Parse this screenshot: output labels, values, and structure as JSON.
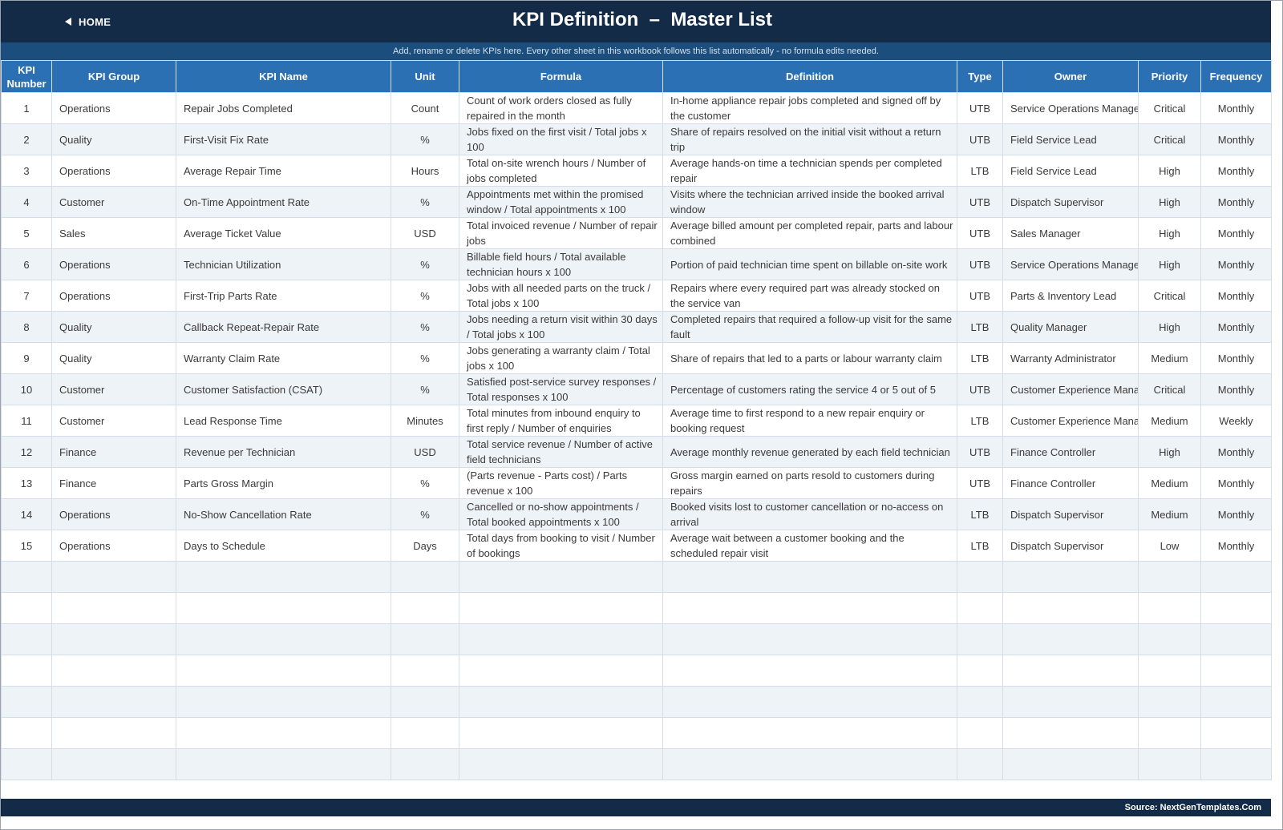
{
  "header": {
    "home_label": "HOME",
    "title": "KPI Definition  –  Master List",
    "subtitle": "Add, rename or delete KPIs here. Every other sheet in this workbook follows this list automatically - no formula edits needed."
  },
  "table": {
    "columns": [
      "KPI Number",
      "KPI Group",
      "KPI Name",
      "Unit",
      "Formula",
      "Definition",
      "Type",
      "Owner",
      "Priority",
      "Frequency"
    ],
    "rows": [
      {
        "number": "1",
        "group": "Operations",
        "name": "Repair Jobs Completed",
        "unit": "Count",
        "formula": "Count of work orders closed as fully repaired in the month",
        "definition": "In-home appliance repair jobs completed and signed off by the customer",
        "type": "UTB",
        "owner": "Service Operations Manager",
        "priority": "Critical",
        "frequency": "Monthly"
      },
      {
        "number": "2",
        "group": "Quality",
        "name": "First-Visit Fix Rate",
        "unit": "%",
        "formula": "Jobs fixed on the first visit / Total jobs x 100",
        "definition": "Share of repairs resolved on the initial visit without a return trip",
        "type": "UTB",
        "owner": "Field Service Lead",
        "priority": "Critical",
        "frequency": "Monthly"
      },
      {
        "number": "3",
        "group": "Operations",
        "name": "Average Repair Time",
        "unit": "Hours",
        "formula": "Total on-site wrench hours / Number of jobs completed",
        "definition": "Average hands-on time a technician spends per completed repair",
        "type": "LTB",
        "owner": "Field Service Lead",
        "priority": "High",
        "frequency": "Monthly"
      },
      {
        "number": "4",
        "group": "Customer",
        "name": "On-Time Appointment Rate",
        "unit": "%",
        "formula": "Appointments met within the promised window / Total appointments x 100",
        "definition": "Visits where the technician arrived inside the booked arrival window",
        "type": "UTB",
        "owner": "Dispatch Supervisor",
        "priority": "High",
        "frequency": "Monthly"
      },
      {
        "number": "5",
        "group": "Sales",
        "name": "Average Ticket Value",
        "unit": "USD",
        "formula": "Total invoiced revenue / Number of repair jobs",
        "definition": "Average billed amount per completed repair, parts and labour combined",
        "type": "UTB",
        "owner": "Sales Manager",
        "priority": "High",
        "frequency": "Monthly"
      },
      {
        "number": "6",
        "group": "Operations",
        "name": "Technician Utilization",
        "unit": "%",
        "formula": "Billable field hours / Total available technician hours x 100",
        "definition": "Portion of paid technician time spent on billable on-site work",
        "type": "UTB",
        "owner": "Service Operations Manager",
        "priority": "High",
        "frequency": "Monthly"
      },
      {
        "number": "7",
        "group": "Operations",
        "name": "First-Trip Parts Rate",
        "unit": "%",
        "formula": "Jobs with all needed parts on the truck / Total jobs x 100",
        "definition": "Repairs where every required part was already stocked on the service van",
        "type": "UTB",
        "owner": "Parts & Inventory Lead",
        "priority": "Critical",
        "frequency": "Monthly"
      },
      {
        "number": "8",
        "group": "Quality",
        "name": "Callback Repeat-Repair Rate",
        "unit": "%",
        "formula": "Jobs needing a return visit within 30 days / Total jobs x 100",
        "definition": "Completed repairs that required a follow-up visit for the same fault",
        "type": "LTB",
        "owner": "Quality Manager",
        "priority": "High",
        "frequency": "Monthly"
      },
      {
        "number": "9",
        "group": "Quality",
        "name": "Warranty Claim Rate",
        "unit": "%",
        "formula": "Jobs generating a warranty claim / Total jobs x 100",
        "definition": "Share of repairs that led to a parts or labour warranty claim",
        "type": "LTB",
        "owner": "Warranty Administrator",
        "priority": "Medium",
        "frequency": "Monthly"
      },
      {
        "number": "10",
        "group": "Customer",
        "name": "Customer Satisfaction (CSAT)",
        "unit": "%",
        "formula": "Satisfied post-service survey responses / Total responses x 100",
        "definition": "Percentage of customers rating the service 4 or 5 out of 5",
        "type": "UTB",
        "owner": "Customer Experience Manager",
        "priority": "Critical",
        "frequency": "Monthly"
      },
      {
        "number": "11",
        "group": "Customer",
        "name": "Lead Response Time",
        "unit": "Minutes",
        "formula": "Total minutes from inbound enquiry to first reply / Number of enquiries",
        "definition": "Average time to first respond to a new repair enquiry or booking request",
        "type": "LTB",
        "owner": "Customer Experience Manager",
        "priority": "Medium",
        "frequency": "Weekly"
      },
      {
        "number": "12",
        "group": "Finance",
        "name": "Revenue per Technician",
        "unit": "USD",
        "formula": "Total service revenue / Number of active field technicians",
        "definition": "Average monthly revenue generated by each field technician",
        "type": "UTB",
        "owner": "Finance Controller",
        "priority": "High",
        "frequency": "Monthly"
      },
      {
        "number": "13",
        "group": "Finance",
        "name": "Parts Gross Margin",
        "unit": "%",
        "formula": "(Parts revenue - Parts cost) / Parts revenue x 100",
        "definition": "Gross margin earned on parts resold to customers during repairs",
        "type": "UTB",
        "owner": "Finance Controller",
        "priority": "Medium",
        "frequency": "Monthly"
      },
      {
        "number": "14",
        "group": "Operations",
        "name": "No-Show Cancellation Rate",
        "unit": "%",
        "formula": "Cancelled or no-show appointments / Total booked appointments x 100",
        "definition": "Booked visits lost to customer cancellation or no-access on arrival",
        "type": "LTB",
        "owner": "Dispatch Supervisor",
        "priority": "Medium",
        "frequency": "Monthly"
      },
      {
        "number": "15",
        "group": "Operations",
        "name": "Days to Schedule",
        "unit": "Days",
        "formula": "Total days from booking to visit / Number of bookings",
        "definition": "Average wait between a customer booking and the scheduled repair visit",
        "type": "LTB",
        "owner": "Dispatch Supervisor",
        "priority": "Low",
        "frequency": "Monthly"
      }
    ],
    "empty_rows": 7
  },
  "footer": {
    "source": "Source: NextGenTemplates.Com"
  },
  "colors": {
    "banner": "#132b47",
    "subtitle_bar": "#1b4e7d",
    "header_row": "#2a70b3",
    "alt_row": "#eef3f8"
  },
  "icons": {
    "home": "left-triangle-icon"
  }
}
